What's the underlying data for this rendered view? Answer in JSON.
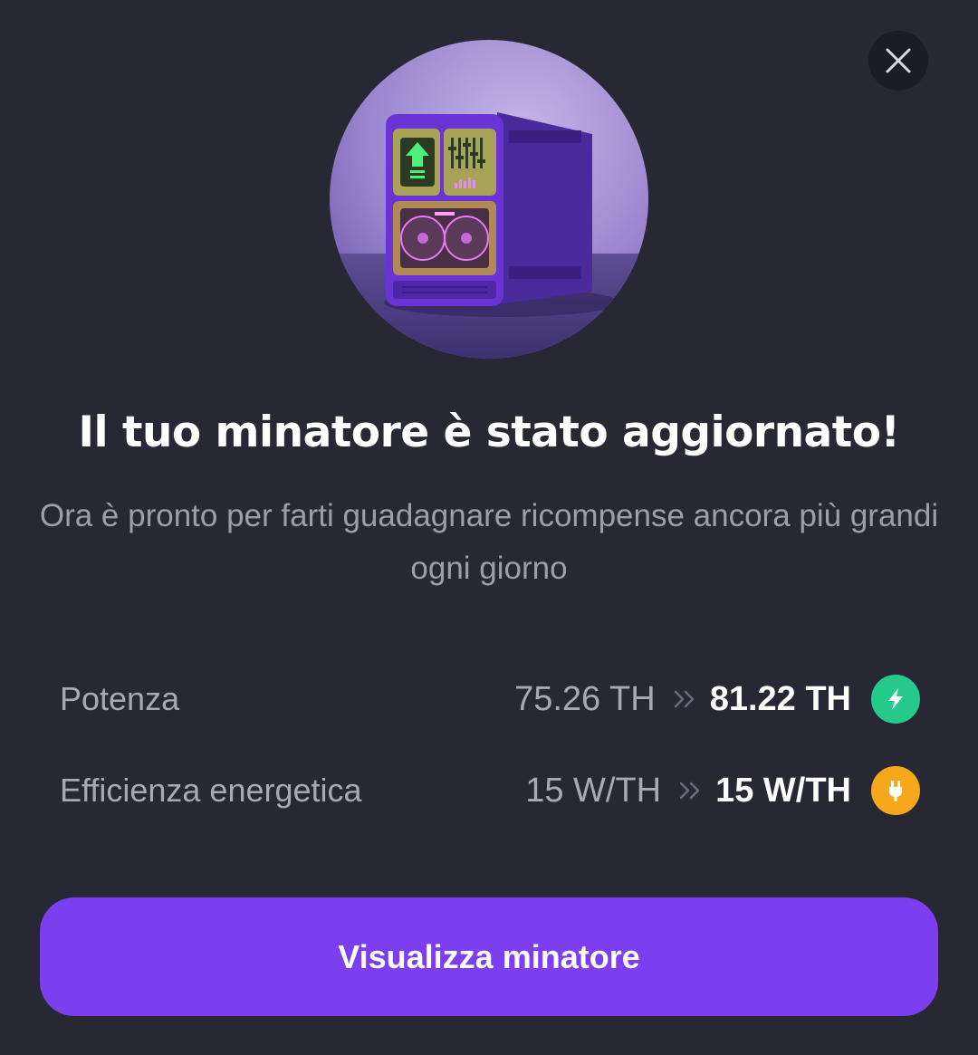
{
  "dialog": {
    "title": "Il tuo minatore è stato aggiornato!",
    "subtitle": "Ora è pronto per farti guadagnare ricompense ancora più grandi ogni giorno"
  },
  "stats": [
    {
      "label": "Potenza",
      "old": "75.26 TH",
      "new": "81.22 TH",
      "icon": "lightning-bolt-icon",
      "color": "#25c98a"
    },
    {
      "label": "Efficienza energetica",
      "old": "15 W/TH",
      "new": "15 W/TH",
      "icon": "power-plug-icon",
      "color": "#f5a81b"
    }
  ],
  "button": {
    "label": "Visualizza minatore"
  },
  "colors": {
    "accent": "#7b3ff0",
    "background": "#272834"
  }
}
